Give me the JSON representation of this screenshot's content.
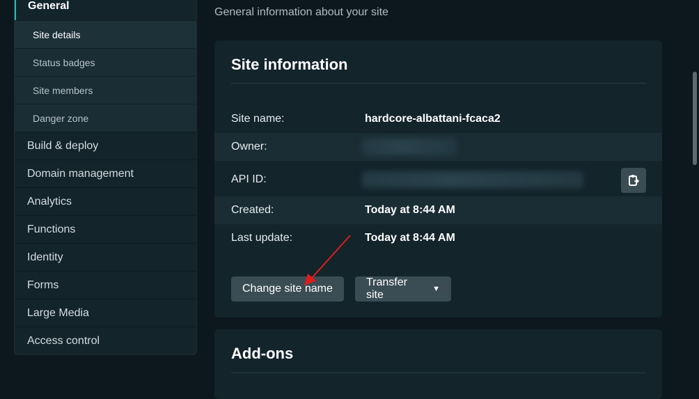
{
  "sidebar": {
    "items": [
      {
        "label": "General"
      },
      {
        "label": "Build & deploy"
      },
      {
        "label": "Domain management"
      },
      {
        "label": "Analytics"
      },
      {
        "label": "Functions"
      },
      {
        "label": "Identity"
      },
      {
        "label": "Forms"
      },
      {
        "label": "Large Media"
      },
      {
        "label": "Access control"
      }
    ],
    "subitems": [
      {
        "label": "Site details"
      },
      {
        "label": "Status badges"
      },
      {
        "label": "Site members"
      },
      {
        "label": "Danger zone"
      }
    ]
  },
  "main": {
    "subtitle": "General information about your site",
    "site_info": {
      "title": "Site information",
      "rows": [
        {
          "label": "Site name:",
          "value": "hardcore-albattani-fcaca2"
        },
        {
          "label": "Owner:",
          "value": ""
        },
        {
          "label": "API ID:",
          "value": ""
        },
        {
          "label": "Created:",
          "value": "Today at 8:44 AM"
        },
        {
          "label": "Last update:",
          "value": "Today at 8:44 AM"
        }
      ],
      "change_name_label": "Change site name",
      "transfer_label": "Transfer site"
    },
    "addons": {
      "title": "Add-ons"
    }
  },
  "colors": {
    "accent": "#2cc0b8",
    "annotation_arrow": "#e01b1b"
  }
}
